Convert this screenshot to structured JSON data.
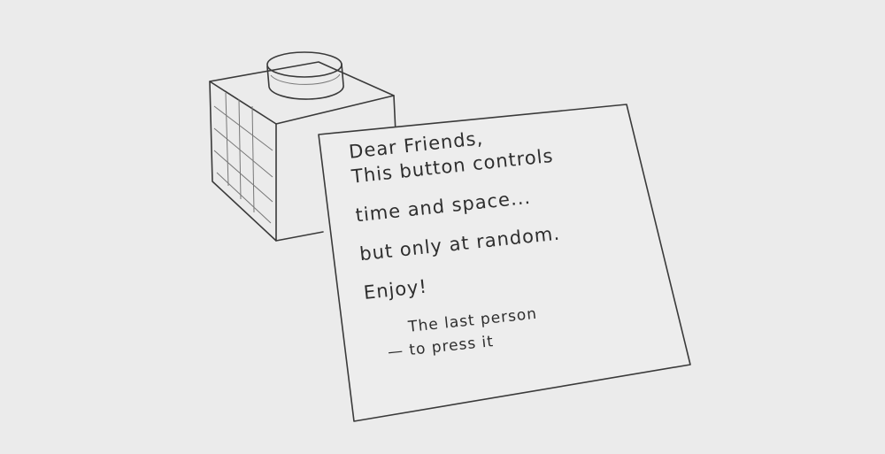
{
  "note": {
    "lines": [
      "Dear Friends,",
      "This button controls",
      "time and space...",
      "but only at random.",
      "Enjoy!"
    ],
    "signature": [
      "The last person",
      "— to press it"
    ]
  },
  "colors": {
    "paper": "#ebebeb",
    "pencil": "#3a3a3a"
  }
}
